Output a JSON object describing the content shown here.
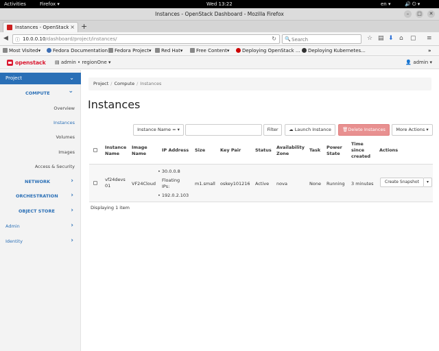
{
  "gnome": {
    "activities": "Activities",
    "app_name": "Firefox",
    "clock": "Wed 13:22",
    "lang": "en"
  },
  "firefox": {
    "window_title": "Instances - OpenStack Dashboard - Mozilla Firefox",
    "tab_title": "Instances - OpenStack",
    "url_host": "10.0.0.10",
    "url_path": "/dashboard/project/instances/",
    "search_placeholder": "Search",
    "bookmarks": [
      {
        "label": "Most Visited",
        "icon_color": "#888888"
      },
      {
        "label": "Fedora Documentation",
        "icon_color": "#3c6eb4"
      },
      {
        "label": "Fedora Project",
        "icon_color": "#3c6eb4"
      },
      {
        "label": "Red Hat",
        "icon_color": "#cc0000"
      },
      {
        "label": "Free Content",
        "icon_color": "#888888"
      },
      {
        "label": "Deploying OpenStack ...",
        "icon_color": "#cc0000"
      },
      {
        "label": "Deploying Kubernetes...",
        "icon_color": "#333333"
      }
    ]
  },
  "openstack": {
    "brand": "openstack",
    "brand_color": "#da1a32",
    "project_selector": "admin • regionOne",
    "user": "admin"
  },
  "sidebar": {
    "project": "Project",
    "compute": "COMPUTE",
    "overview": "Overview",
    "instances": "Instances",
    "volumes": "Volumes",
    "images": "Images",
    "access_security": "Access & Security",
    "network": "NETWORK",
    "orchestration": "ORCHESTRATION",
    "object_store": "OBJECT STORE",
    "admin": "Admin",
    "identity": "Identity"
  },
  "main": {
    "breadcrumb": [
      "Project",
      "Compute",
      "Instances"
    ],
    "title": "Instances",
    "filter_select": "Instance Name =",
    "filter_button": "Filter",
    "launch_button": "Launch Instance",
    "delete_button": "Delete Instances",
    "more_button": "More Actions",
    "columns": [
      "Instance Name",
      "Image Name",
      "IP Address",
      "Size",
      "Key Pair",
      "Status",
      "Availability Zone",
      "Task",
      "Power State",
      "Time since created",
      "Actions"
    ],
    "row": {
      "instance_name": "vf24devs01",
      "image_name": "VF24Cloud",
      "ip_fixed": "30.0.0.8",
      "floating_label": "Floating IPs:",
      "ip_floating": "192.0.2.103",
      "size": "m1.small",
      "key_pair": "oskey101216",
      "status": "Active",
      "zone": "nova",
      "task": "None",
      "power_state": "Running",
      "age": "3 minutes",
      "action": "Create Snapshot"
    },
    "display_count": "Displaying 1 item"
  }
}
